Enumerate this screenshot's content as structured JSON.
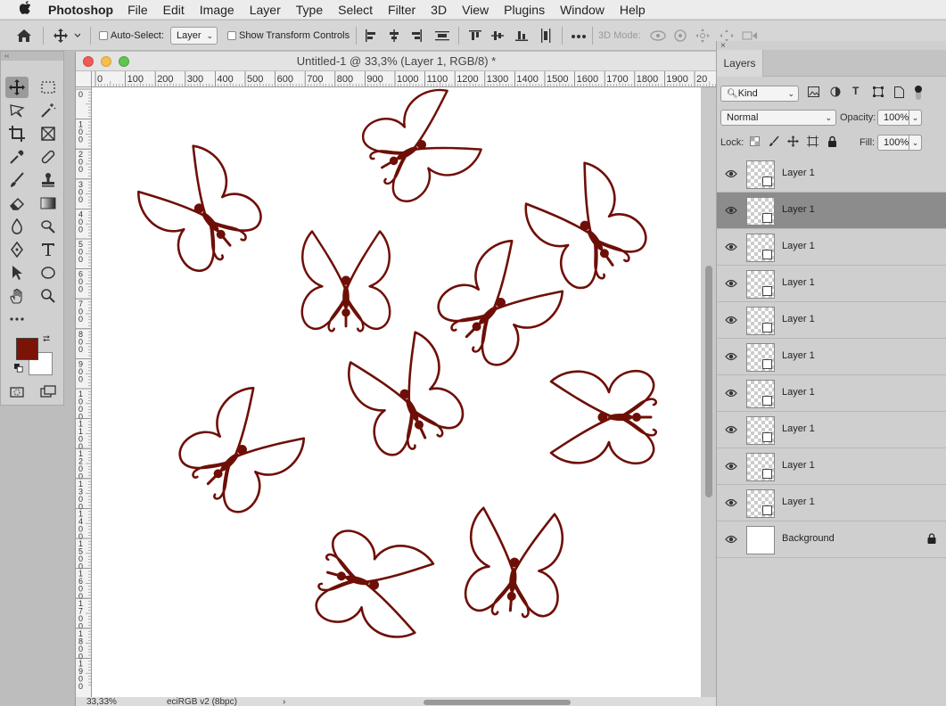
{
  "menubar": {
    "apple": "",
    "app": "Photoshop",
    "items": [
      "File",
      "Edit",
      "Image",
      "Layer",
      "Type",
      "Select",
      "Filter",
      "3D",
      "View",
      "Plugins",
      "Window",
      "Help"
    ]
  },
  "options": {
    "auto_select_label": "Auto-Select:",
    "auto_select_value": "Layer",
    "show_transform_label": "Show Transform Controls",
    "mode_3d_label": "3D Mode:"
  },
  "document": {
    "title": "Untitled-1 @ 33,3% (Layer 1, RGB/8) *",
    "ruler_h": [
      "0",
      "100",
      "200",
      "300",
      "400",
      "500",
      "600",
      "700",
      "800",
      "900",
      "1000",
      "1100",
      "1200",
      "1300",
      "1400",
      "1500",
      "1600",
      "1700",
      "1800",
      "1900",
      "20"
    ],
    "ruler_v": [
      "0",
      "1 0 0",
      "2 0 0",
      "3 0 0",
      "4 0 0",
      "5 0 0",
      "6 0 0",
      "7 0 0",
      "8 0 0",
      "9 0 0",
      "1 0 0 0",
      "1 1 0 0",
      "1 2 0 0",
      "1 3 0 0",
      "1 4 0 0",
      "1 5 0 0",
      "1 6 0 0",
      "1 7 0 0",
      "1 8 0 0",
      "1 9 0 0"
    ],
    "zoom": "33,33%",
    "profile": "eciRGB v2 (8bpc)"
  },
  "colors": {
    "foreground": "#7b1406",
    "background": "#ffffff",
    "butterfly": "#6e0f07"
  },
  "layers_panel": {
    "tab": "Layers",
    "filter_kind": "Kind",
    "blend_mode": "Normal",
    "opacity_label": "Opacity:",
    "opacity_value": "100%",
    "lock_label": "Lock:",
    "fill_label": "Fill:",
    "fill_value": "100%",
    "layers": [
      {
        "name": "Layer 1",
        "selected": false,
        "type": "smart"
      },
      {
        "name": "Layer 1",
        "selected": true,
        "type": "smart"
      },
      {
        "name": "Layer 1",
        "selected": false,
        "type": "smart"
      },
      {
        "name": "Layer 1",
        "selected": false,
        "type": "smart"
      },
      {
        "name": "Layer 1",
        "selected": false,
        "type": "smart"
      },
      {
        "name": "Layer 1",
        "selected": false,
        "type": "smart"
      },
      {
        "name": "Layer 1",
        "selected": false,
        "type": "smart"
      },
      {
        "name": "Layer 1",
        "selected": false,
        "type": "smart"
      },
      {
        "name": "Layer 1",
        "selected": false,
        "type": "smart"
      },
      {
        "name": "Layer 1",
        "selected": false,
        "type": "smart"
      },
      {
        "name": "Background",
        "selected": false,
        "type": "background",
        "locked": true
      }
    ]
  }
}
